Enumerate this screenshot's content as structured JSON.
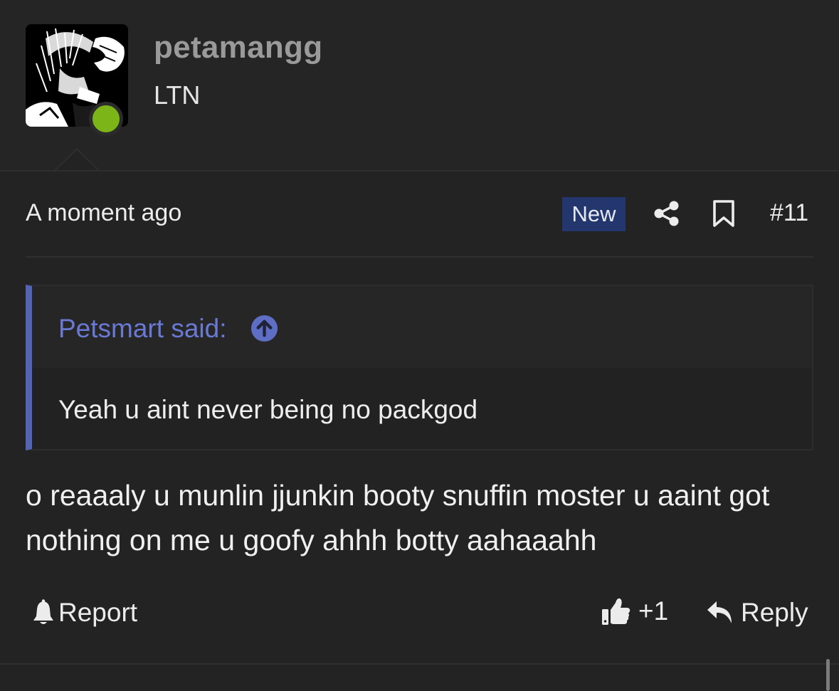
{
  "user": {
    "username": "petamangg",
    "title": "LTN",
    "avatar_icon": "anime-character-avatar",
    "online_color": "#7cb518"
  },
  "post": {
    "timestamp": "A moment ago",
    "badge": "New",
    "number": "#11",
    "share_icon": "share-icon",
    "bookmark_icon": "bookmark-icon",
    "body": "o reaaaly u munlin jjunkin booty snuffin moster u aaint got nothing on me u goofy ahhh botty aahaaahh"
  },
  "quote": {
    "author_label": "Petsmart said:",
    "text": "Yeah u aint never being no packgod",
    "accent_color": "#5464b4"
  },
  "actions": {
    "report_label": "Report",
    "like_count": "+1",
    "reply_label": "Reply"
  },
  "colors": {
    "background": "#232324",
    "badge_bg": "#23376e",
    "quote_link": "#6a7ad4"
  }
}
